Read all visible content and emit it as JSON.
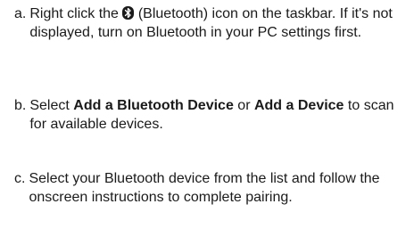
{
  "steps": [
    {
      "label": "a.",
      "before_icon": "Right click the ",
      "icon": "bluetooth-icon",
      "after_icon": " (Bluetooth) icon on the taskbar. If it's not displayed, turn on Bluetooth in your PC settings first."
    },
    {
      "label": "b.",
      "text_1": "Select ",
      "bold_1": "Add a Bluetooth Device",
      "text_2": " or ",
      "bold_2": "Add a Device",
      "text_3": " to scan for available devices."
    },
    {
      "label": "c.",
      "text": "Select your Bluetooth device from the list and follow the onscreen instructions to complete pairing."
    }
  ]
}
